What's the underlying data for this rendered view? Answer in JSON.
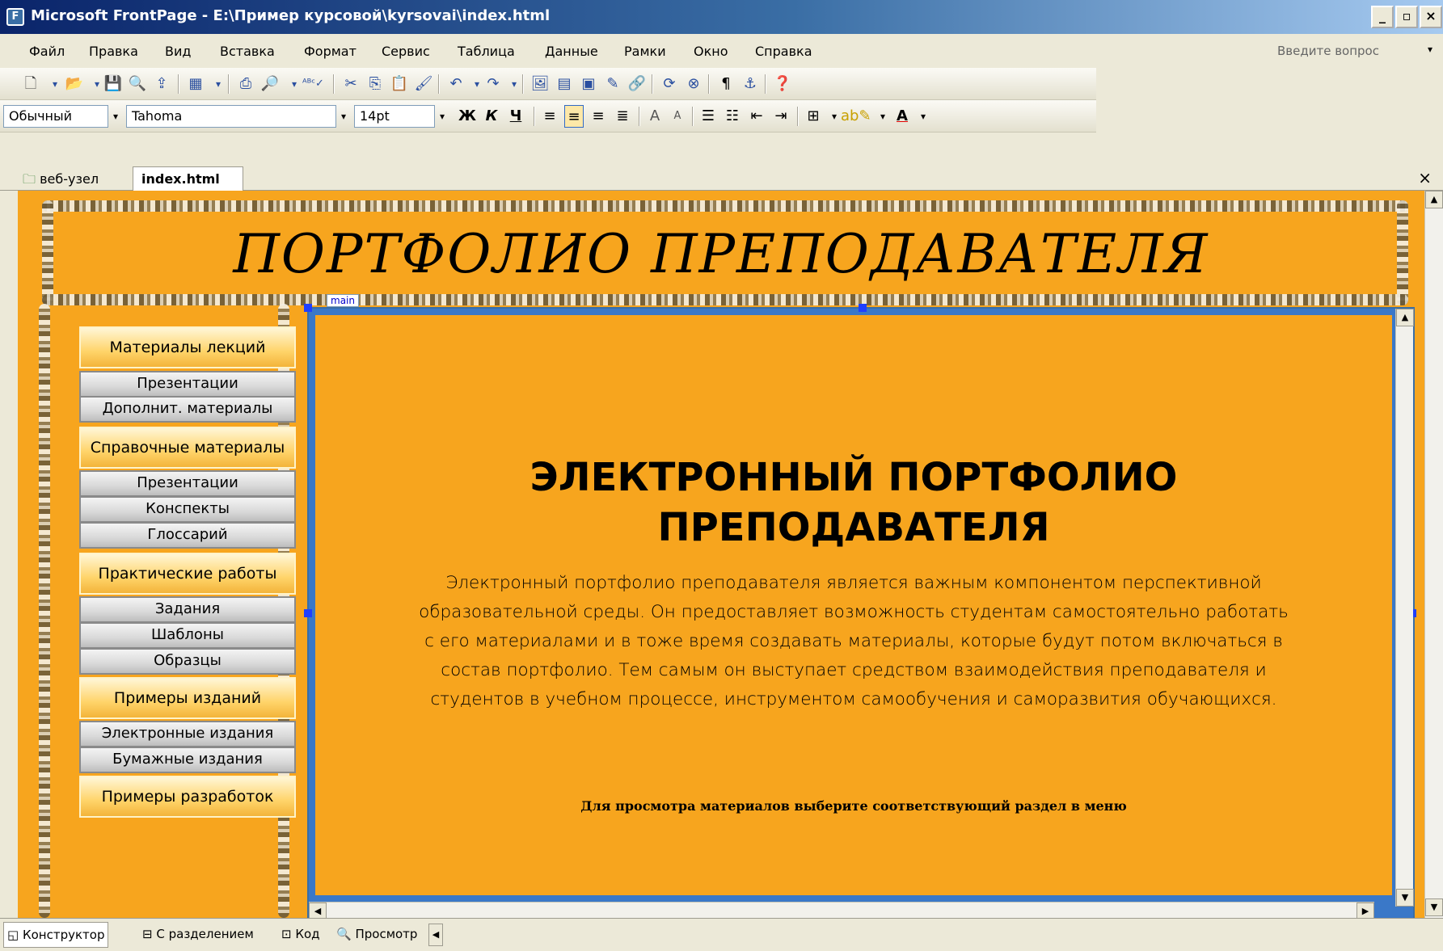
{
  "window": {
    "title": "Microsoft FrontPage - E:\\Пример курсовой\\kyrsovai\\index.html",
    "controls": [
      "_",
      "▫",
      "×"
    ]
  },
  "menubar": {
    "items": [
      "Файл",
      "Правка",
      "Вид",
      "Вставка",
      "Формат",
      "Сервис",
      "Таблица",
      "Данные",
      "Рамки",
      "Окно",
      "Справка"
    ],
    "help_placeholder": "Введите вопрос"
  },
  "toolbar_standard": {
    "icons": [
      "new-page-icon",
      "open-icon",
      "save-icon",
      "search-icon",
      "publish-icon",
      "web-component-icon",
      "print-icon",
      "print-preview-icon",
      "spelling-icon",
      "cut-icon",
      "copy-icon",
      "paste-icon",
      "format-painter-icon",
      "undo-icon",
      "redo-icon",
      "insert-image-icon",
      "insert-table-icon",
      "insert-layer-icon",
      "drawing-icon",
      "hyperlink-icon",
      "refresh-icon",
      "stop-icon",
      "pilcrow-icon",
      "help-icon"
    ]
  },
  "toolbar_format": {
    "style": "Обычный",
    "font": "Tahoma",
    "size": "14pt",
    "bold": "Ж",
    "italic": "К",
    "underline": "Ч",
    "grow_font": "A",
    "shrink_font": "A",
    "font_color": "A"
  },
  "doc_tabs": {
    "site": "веб-узел",
    "current": "index.html"
  },
  "page": {
    "banner_title": "ПОРТФОЛИО   ПРЕПОДАВАТЕЛЯ",
    "frame_label": "main",
    "nav": [
      {
        "kind": "header",
        "label": "Материалы лекций"
      },
      {
        "kind": "sub",
        "label": "Презентации"
      },
      {
        "kind": "sub",
        "label": "Дополнит. материалы"
      },
      {
        "kind": "header",
        "label": "Справочные материалы"
      },
      {
        "kind": "sub",
        "label": "Презентации"
      },
      {
        "kind": "sub",
        "label": "Конспекты"
      },
      {
        "kind": "sub",
        "label": "Глоссарий"
      },
      {
        "kind": "header",
        "label": "Практические работы"
      },
      {
        "kind": "sub",
        "label": "Задания"
      },
      {
        "kind": "sub",
        "label": "Шаблоны"
      },
      {
        "kind": "sub",
        "label": "Образцы"
      },
      {
        "kind": "header",
        "label": "Примеры изданий"
      },
      {
        "kind": "sub",
        "label": "Электронные издания"
      },
      {
        "kind": "sub",
        "label": "Бумажные издания"
      },
      {
        "kind": "header",
        "label": "Примеры разработок"
      }
    ],
    "main_heading_line1": "ЭЛЕКТРОННЫЙ ПОРТФОЛИО",
    "main_heading_line2": "ПРЕПОДАВАТЕЛЯ",
    "main_paragraph_lines": [
      "Электронный портфолио преподавателя является важным компонентом перспективной",
      "образовательной среды. Он предоставляет возможность студентам самостоятельно работать",
      "с его материалами и в тоже время создавать материалы, которые будут потом включаться в",
      "состав портфолио. Тем самым он выступает средством взаимодействия преподавателя и",
      "студентов в учебном процессе, инструментом самообучения и саморазвития обучающихся."
    ],
    "main_note": "Для просмотра материалов выберите соответствующий раздел в меню"
  },
  "view_tabs": {
    "design": "Конструктор",
    "split": "С разделением",
    "code": "Код",
    "preview": "Просмотр"
  }
}
